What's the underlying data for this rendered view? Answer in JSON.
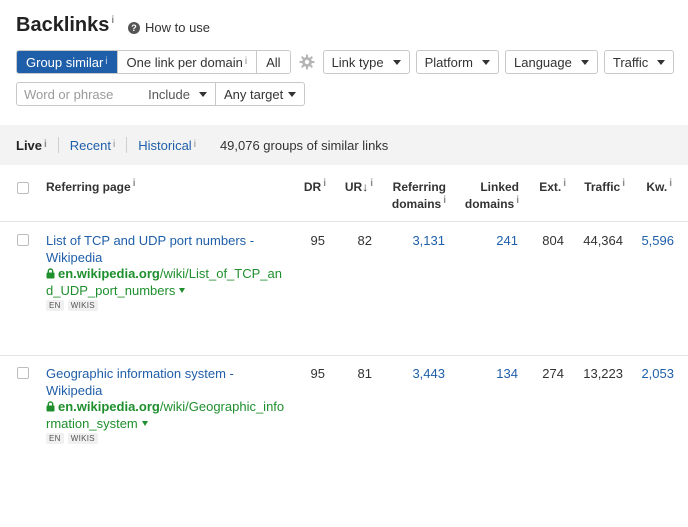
{
  "header": {
    "title": "Backlinks",
    "title_info": "i",
    "help_label": "How to use"
  },
  "grouping": {
    "options": [
      {
        "label": "Group similar",
        "info": "i",
        "active": true
      },
      {
        "label": "One link per domain",
        "info": "i",
        "active": false
      },
      {
        "label": "All",
        "info": "",
        "active": false
      }
    ]
  },
  "filters": {
    "link_type": "Link type",
    "platform": "Platform",
    "language": "Language",
    "traffic": "Traffic"
  },
  "search": {
    "placeholder": "Word or phrase",
    "value": "",
    "mode": "Include",
    "target": "Any target"
  },
  "tabs": [
    {
      "label": "Live",
      "info": "i",
      "active": true
    },
    {
      "label": "Recent",
      "info": "i",
      "active": false
    },
    {
      "label": "Historical",
      "info": "i",
      "active": false
    }
  ],
  "summary": "49,076 groups of similar links",
  "table": {
    "columns": {
      "referring_page": "Referring page",
      "dr": "DR",
      "ur": "UR",
      "ur_sort": "↓",
      "referring_domains_1": "Referring",
      "referring_domains_2": "domains",
      "linked_domains_1": "Linked",
      "linked_domains_2": "domains",
      "ext": "Ext.",
      "traffic": "Traffic",
      "kw": "Kw.",
      "info": "i"
    },
    "rows": [
      {
        "title": "List of TCP and UDP port numbers - Wikipedia",
        "domain": "en.wikipedia.org",
        "path": "/wiki/List_of_TCP_and_UDP_port_numbers",
        "tags": [
          "EN",
          "WIKIS"
        ],
        "dr": "95",
        "ur": "82",
        "referring_domains": "3,131",
        "linked_domains": "241",
        "ext": "804",
        "traffic": "44,364",
        "kw": "5,596"
      },
      {
        "title": "Geographic information system - Wikipedia",
        "domain": "en.wikipedia.org",
        "path": "/wiki/Geographic_information_system",
        "tags": [
          "EN",
          "WIKIS"
        ],
        "dr": "95",
        "ur": "81",
        "referring_domains": "3,443",
        "linked_domains": "134",
        "ext": "274",
        "traffic": "13,223",
        "kw": "2,053"
      }
    ]
  },
  "colors": {
    "accent": "#1f5fa9",
    "url_green": "#1f8f2e",
    "tabs_bg": "#f3f3f3"
  }
}
